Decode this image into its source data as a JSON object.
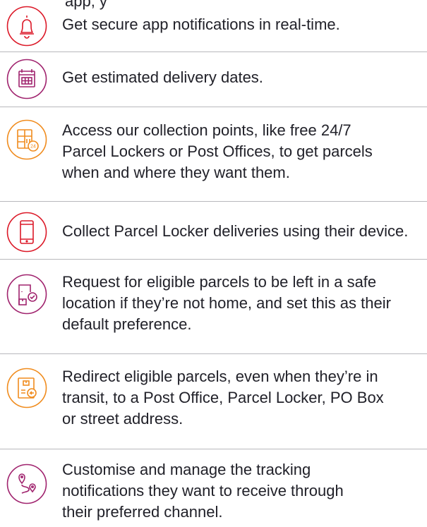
{
  "top_fragment": "app, y",
  "items": [
    {
      "icon": "bell-icon",
      "color": "#dc1928",
      "text": "Get secure app notifications in real-time."
    },
    {
      "icon": "calendar-icon",
      "color": "#a0236e",
      "text": "Get estimated delivery dates."
    },
    {
      "icon": "parcel-locker-24-icon",
      "color": "#f08c1e",
      "text": "Access our collection points, like free 24/7\nParcel Lockers or Post Offices, to get parcels\nwhen and where they want them."
    },
    {
      "icon": "mobile-device-icon",
      "color": "#dc1928",
      "text": "Collect Parcel Locker deliveries using their device."
    },
    {
      "icon": "safe-drop-icon",
      "color": "#a0236e",
      "text": "Request for eligible parcels to be left in a safe\nlocation if they’re not home, and set this as their\ndefault preference."
    },
    {
      "icon": "redirect-parcel-icon",
      "color": "#f08c1e",
      "text": "Redirect eligible parcels, even when they’re in\ntransit, to a Post Office, Parcel Locker, PO Box\nor street address."
    },
    {
      "icon": "tracking-route-icon",
      "color": "#a0236e",
      "text": "Customise and manage the tracking\nnotifications they want to receive through\ntheir preferred channel."
    }
  ]
}
